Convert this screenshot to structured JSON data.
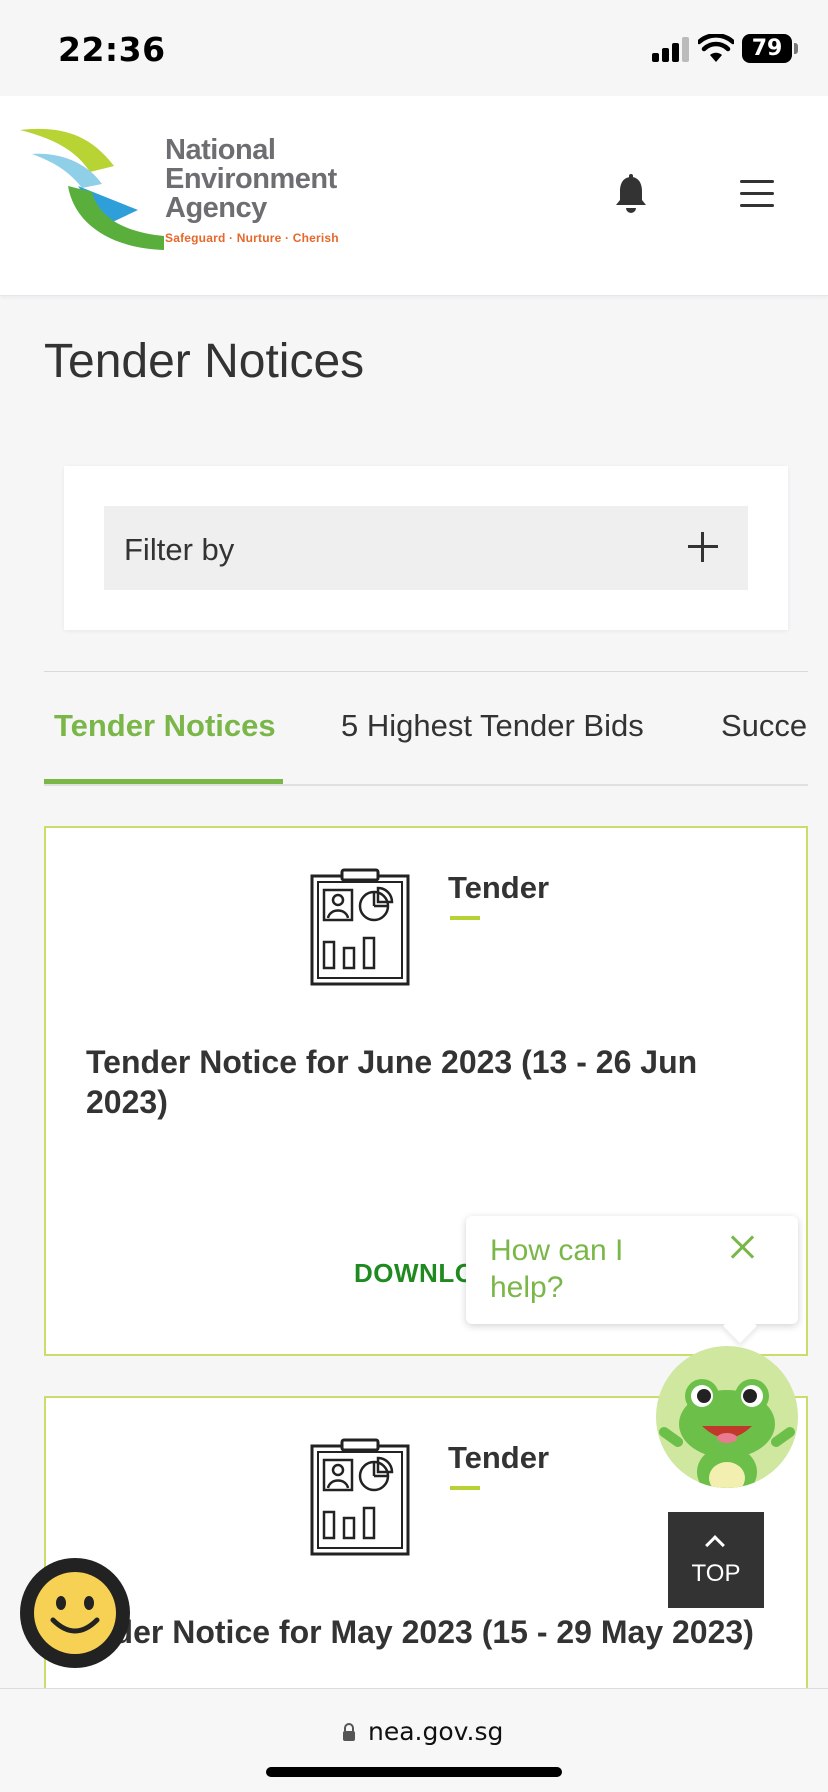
{
  "status_bar": {
    "time": "22:36",
    "battery": "79"
  },
  "header": {
    "logo_lines": [
      "National",
      "Environment",
      "Agency"
    ],
    "logo_tagline": "Safeguard · Nurture · Cherish",
    "icons": [
      "bell-icon",
      "hamburger-menu-icon"
    ]
  },
  "page": {
    "title": "Tender Notices"
  },
  "filter": {
    "label": "Filter by",
    "icon": "plus-icon"
  },
  "tabs": [
    {
      "label": "Tender Notices",
      "active": true
    },
    {
      "label": "5 Highest Tender Bids",
      "active": false
    },
    {
      "label": "Succe",
      "active": false
    }
  ],
  "cards": [
    {
      "category": "Tender",
      "title": "Tender Notice for June 2023 (13 - 26 Jun 2023)",
      "action": "DOWNLO"
    },
    {
      "category": "Tender",
      "title": "nder Notice for May 2023 (15 - 29 May 2023)"
    }
  ],
  "chat": {
    "prompt": "How can I help?"
  },
  "scroll_top": {
    "label": "TOP"
  },
  "url_bar": {
    "url": "nea.gov.sg"
  },
  "colors": {
    "accent_green": "#7ab648",
    "card_border": "#c7de6a",
    "download_green": "#1f8a1f"
  }
}
